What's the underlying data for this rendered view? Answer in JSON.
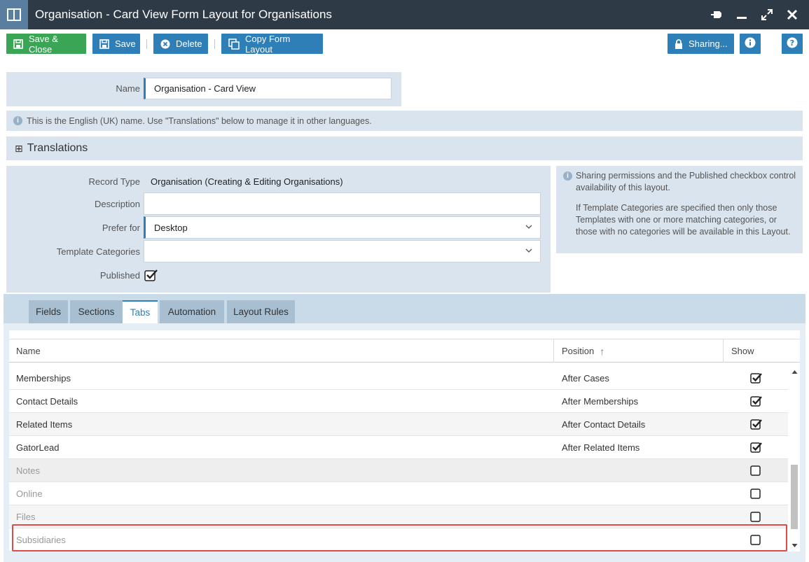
{
  "window": {
    "title": "Organisation - Card View Form Layout for Organisations"
  },
  "toolbar": {
    "save_close": "Save & Close",
    "save": "Save",
    "delete": "Delete",
    "copy_form_layout": "Copy Form Layout",
    "sharing": "Sharing..."
  },
  "name_section": {
    "label": "Name",
    "value": "Organisation - Card View",
    "info": "This is the English (UK) name. Use \"Translations\" below to manage it in other languages."
  },
  "translations": {
    "toggle": "⊞",
    "label": "Translations"
  },
  "details": {
    "record_type_label": "Record Type",
    "record_type_value": "Organisation (Creating & Editing Organisations)",
    "description_label": "Description",
    "description_value": "",
    "prefer_for_label": "Prefer for",
    "prefer_for_value": "Desktop",
    "template_categories_label": "Template Categories",
    "template_categories_value": "",
    "published_label": "Published",
    "published": true
  },
  "side_info": {
    "p1": "Sharing permissions and the Published checkbox control availability of this layout.",
    "p2": "If Template Categories are specified then only those Templates with one or more matching categories, or those with no categories will be available in this Layout."
  },
  "tabs": [
    {
      "label": "Fields",
      "active": false
    },
    {
      "label": "Sections",
      "active": false
    },
    {
      "label": "Tabs",
      "active": true
    },
    {
      "label": "Automation",
      "active": false
    },
    {
      "label": "Layout Rules",
      "active": false
    }
  ],
  "grid": {
    "columns": {
      "name": "Name",
      "position": "Position",
      "sort_icon": "↑",
      "show": "Show"
    },
    "rows": [
      {
        "name": "Memberships",
        "position": "After Cases",
        "show": true,
        "style": "normal"
      },
      {
        "name": "Contact Details",
        "position": "After Memberships",
        "show": true,
        "style": "normal"
      },
      {
        "name": "Related Items",
        "position": "After Contact Details",
        "show": true,
        "style": "alt"
      },
      {
        "name": "GatorLead",
        "position": "After Related Items",
        "show": true,
        "style": "normal"
      },
      {
        "name": "Notes",
        "position": "",
        "show": false,
        "style": "notes"
      },
      {
        "name": "Online",
        "position": "",
        "show": false,
        "style": "dim"
      },
      {
        "name": "Files",
        "position": "",
        "show": false,
        "style": "dimalt"
      },
      {
        "name": "Subsidiaries",
        "position": "",
        "show": false,
        "style": "dim"
      }
    ]
  }
}
